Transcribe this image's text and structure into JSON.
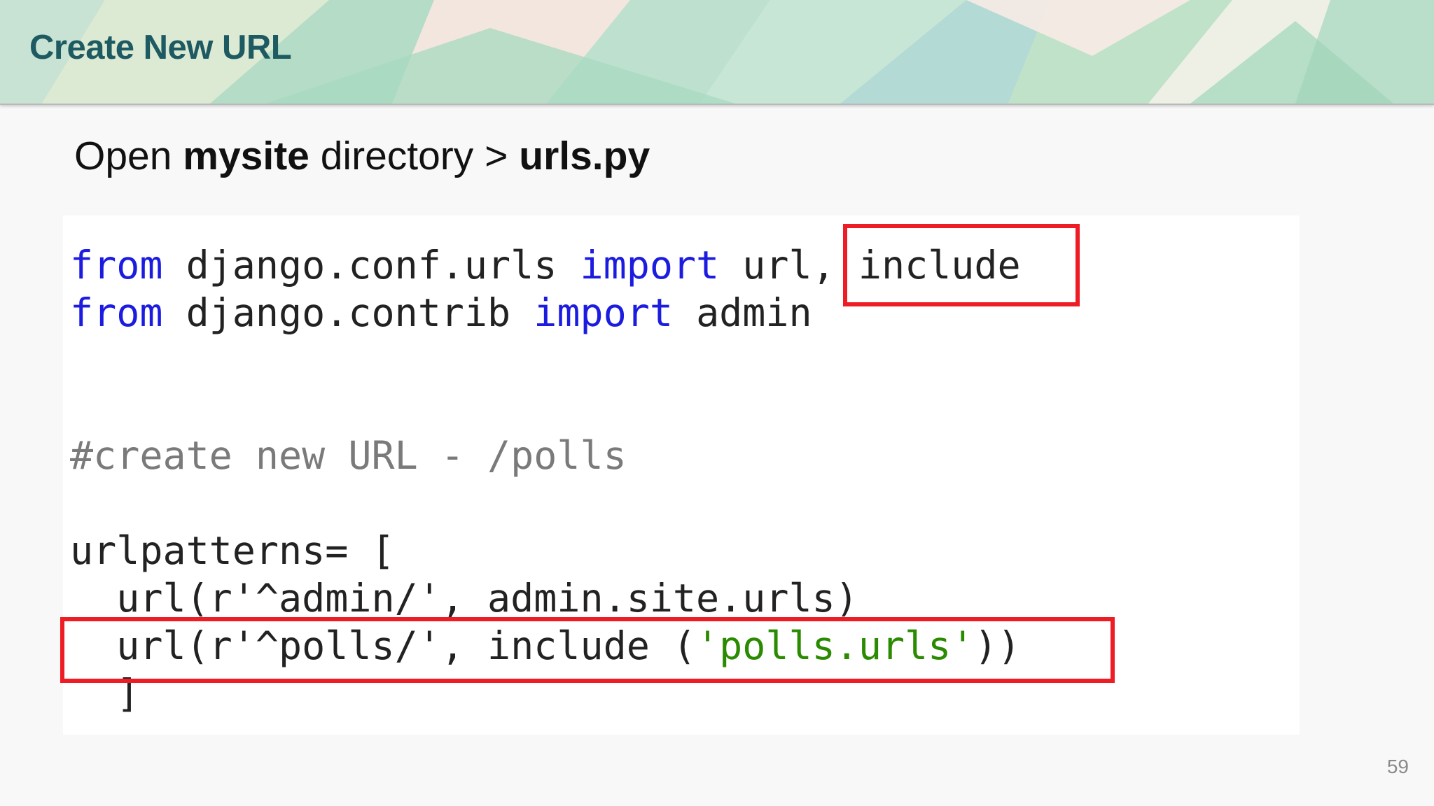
{
  "slide": {
    "title": "Create New URL",
    "subtitle": {
      "prefix": "Open ",
      "folder": "mysite",
      "middle": " directory > ",
      "file": "urls.py"
    },
    "page_number": "59"
  },
  "code": {
    "line1": {
      "kw1": "from",
      "mod": " django.conf.urls ",
      "kw2": "import",
      "names": " url, ",
      "include": "include"
    },
    "line2": {
      "kw1": "from",
      "mod": " django.contrib ",
      "kw2": "import",
      "names": " admin"
    },
    "comment": "#create new URL - /polls",
    "patterns_open": "urlpatterns= [",
    "admin_url": "  url(r'^admin/', admin.site.urls)",
    "polls_url": {
      "prefix": "  url(r'^polls/', include (",
      "arg": "'polls.urls'",
      "suffix": "))"
    },
    "close": "  ]"
  },
  "colors": {
    "title": "#1e5a62",
    "highlight_box": "#ee1c24",
    "keyword": "#1c1ce0",
    "comment": "#7a7a7a",
    "string": "#2a8a00"
  }
}
